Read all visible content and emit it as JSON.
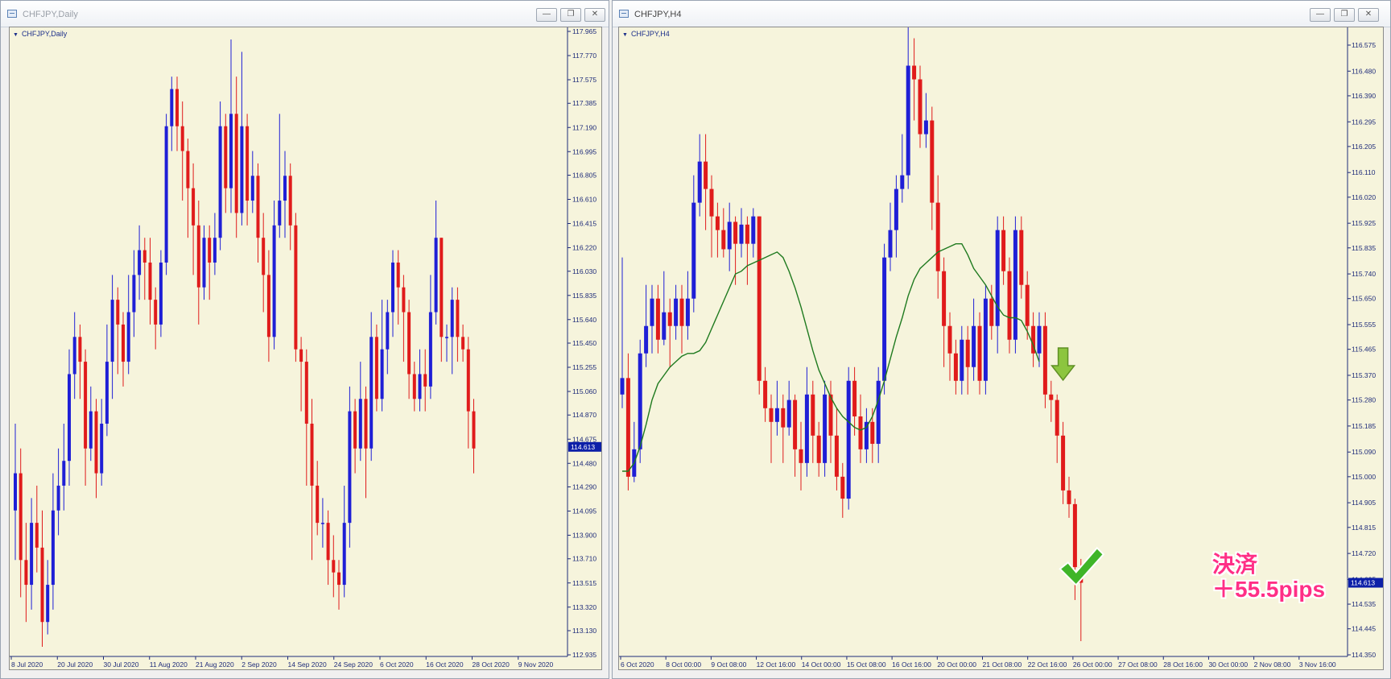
{
  "left_window": {
    "title": "CHFJPY,Daily",
    "chart_label": "CHFJPY,Daily",
    "controls": {
      "minimize": "—",
      "restore": "❐",
      "close": "✕"
    },
    "chart_data": {
      "type": "candlestick",
      "symbol": "CHFJPY",
      "timeframe": "Daily",
      "ylim": [
        112.935,
        117.965
      ],
      "y_ticks": [
        117.965,
        117.77,
        117.575,
        117.385,
        117.19,
        116.995,
        116.805,
        116.61,
        116.415,
        116.22,
        116.03,
        115.835,
        115.64,
        115.45,
        115.255,
        115.06,
        114.87,
        114.675,
        114.48,
        114.29,
        114.095,
        113.9,
        113.71,
        113.515,
        113.32,
        113.13,
        112.935
      ],
      "x_ticks": [
        "8 Jul 2020",
        "20 Jul 2020",
        "30 Jul 2020",
        "11 Aug 2020",
        "21 Aug 2020",
        "2 Sep 2020",
        "14 Sep 2020",
        "24 Sep 2020",
        "6 Oct 2020",
        "16 Oct 2020",
        "28 Oct 2020",
        "9 Nov 2020"
      ],
      "current_price": "114.613",
      "candles": [
        [
          114.1,
          114.4,
          114.8,
          113.7
        ],
        [
          114.4,
          113.7,
          114.6,
          113.4
        ],
        [
          113.7,
          113.5,
          114.0,
          113.2
        ],
        [
          113.5,
          114.0,
          114.2,
          113.3
        ],
        [
          114.0,
          113.8,
          114.3,
          113.6
        ],
        [
          113.8,
          113.2,
          114.1,
          113.0
        ],
        [
          113.2,
          113.5,
          113.7,
          113.1
        ],
        [
          113.5,
          114.1,
          114.4,
          113.3
        ],
        [
          114.1,
          114.3,
          114.6,
          113.9
        ],
        [
          114.3,
          114.5,
          114.8,
          114.1
        ],
        [
          114.5,
          115.2,
          115.4,
          114.3
        ],
        [
          115.2,
          115.5,
          115.7,
          115.0
        ],
        [
          115.5,
          115.3,
          115.6,
          115.0
        ],
        [
          115.3,
          114.6,
          115.4,
          114.3
        ],
        [
          114.6,
          114.9,
          115.1,
          114.5
        ],
        [
          114.9,
          114.4,
          115.0,
          114.2
        ],
        [
          114.4,
          114.8,
          115.0,
          114.3
        ],
        [
          114.8,
          115.3,
          115.6,
          114.7
        ],
        [
          115.3,
          115.8,
          116.0,
          115.0
        ],
        [
          115.8,
          115.6,
          115.9,
          115.2
        ],
        [
          115.6,
          115.3,
          115.7,
          115.1
        ],
        [
          115.3,
          115.7,
          116.0,
          115.2
        ],
        [
          115.7,
          116.0,
          116.2,
          115.5
        ],
        [
          116.0,
          116.2,
          116.4,
          115.8
        ],
        [
          116.2,
          116.1,
          116.3,
          115.8
        ],
        [
          116.1,
          115.8,
          116.3,
          115.6
        ],
        [
          115.8,
          115.6,
          115.9,
          115.4
        ],
        [
          115.6,
          116.1,
          116.2,
          115.5
        ],
        [
          116.1,
          117.2,
          117.3,
          116.0
        ],
        [
          117.2,
          117.5,
          117.6,
          117.0
        ],
        [
          117.5,
          117.2,
          117.6,
          117.0
        ],
        [
          117.2,
          117.0,
          117.4,
          116.6
        ],
        [
          117.0,
          116.7,
          117.1,
          116.3
        ],
        [
          116.7,
          116.4,
          116.9,
          116.0
        ],
        [
          116.4,
          115.9,
          116.6,
          115.6
        ],
        [
          115.9,
          116.3,
          116.4,
          115.8
        ],
        [
          116.3,
          116.1,
          116.4,
          115.8
        ],
        [
          116.1,
          116.3,
          116.5,
          116.0
        ],
        [
          116.3,
          117.2,
          117.4,
          116.2
        ],
        [
          117.2,
          116.7,
          117.3,
          116.5
        ],
        [
          116.7,
          117.3,
          117.9,
          116.5
        ],
        [
          117.3,
          116.5,
          117.6,
          116.3
        ],
        [
          116.5,
          117.2,
          117.8,
          116.4
        ],
        [
          117.2,
          116.6,
          117.3,
          116.4
        ],
        [
          116.6,
          116.8,
          117.0,
          116.5
        ],
        [
          116.8,
          116.3,
          116.9,
          116.1
        ],
        [
          116.3,
          116.0,
          116.5,
          115.7
        ],
        [
          116.0,
          115.5,
          116.2,
          115.3
        ],
        [
          115.5,
          116.4,
          116.6,
          115.4
        ],
        [
          116.4,
          116.6,
          117.3,
          116.3
        ],
        [
          116.6,
          116.8,
          117.0,
          116.3
        ],
        [
          116.8,
          116.4,
          116.9,
          116.2
        ],
        [
          116.4,
          115.4,
          116.5,
          115.3
        ],
        [
          115.4,
          115.3,
          115.5,
          114.9
        ],
        [
          115.3,
          114.8,
          115.4,
          114.3
        ],
        [
          114.8,
          114.3,
          115.0,
          113.7
        ],
        [
          114.3,
          114.0,
          114.5,
          113.9
        ],
        [
          114.0,
          114.0,
          114.2,
          113.8
        ],
        [
          114.0,
          113.7,
          114.1,
          113.5
        ],
        [
          113.7,
          113.6,
          113.9,
          113.4
        ],
        [
          113.6,
          113.5,
          113.7,
          113.3
        ],
        [
          113.5,
          114.0,
          114.3,
          113.4
        ],
        [
          114.0,
          114.9,
          115.1,
          113.8
        ],
        [
          114.9,
          114.6,
          115.0,
          114.4
        ],
        [
          114.6,
          115.0,
          115.3,
          114.5
        ],
        [
          115.0,
          114.6,
          115.1,
          114.2
        ],
        [
          114.6,
          115.5,
          115.7,
          114.5
        ],
        [
          115.5,
          115.0,
          115.6,
          114.9
        ],
        [
          115.0,
          115.4,
          115.8,
          114.9
        ],
        [
          115.4,
          115.7,
          115.8,
          115.2
        ],
        [
          115.7,
          116.1,
          116.2,
          115.5
        ],
        [
          116.1,
          115.9,
          116.2,
          115.6
        ],
        [
          115.9,
          115.7,
          116.0,
          115.3
        ],
        [
          115.7,
          115.2,
          115.8,
          115.0
        ],
        [
          115.2,
          115.0,
          115.3,
          114.9
        ],
        [
          115.0,
          115.2,
          115.4,
          114.9
        ],
        [
          115.2,
          115.1,
          115.4,
          114.9
        ],
        [
          115.1,
          115.7,
          116.0,
          115.0
        ],
        [
          115.7,
          116.3,
          116.6,
          115.6
        ],
        [
          116.3,
          115.5,
          116.3,
          115.3
        ],
        [
          115.5,
          115.5,
          115.6,
          115.3
        ],
        [
          115.5,
          115.8,
          115.9,
          115.2
        ],
        [
          115.8,
          115.5,
          115.9,
          115.3
        ],
        [
          115.5,
          115.4,
          115.6,
          115.3
        ],
        [
          115.4,
          114.9,
          115.5,
          114.6
        ],
        [
          114.9,
          114.6,
          115.0,
          114.4
        ]
      ]
    }
  },
  "right_window": {
    "title": "CHFJPY,H4",
    "chart_label": "CHFJPY,H4",
    "controls": {
      "minimize": "—",
      "restore": "❐",
      "close": "✕"
    },
    "annotation": {
      "line1": "決済",
      "line2": "＋55.5pips"
    },
    "chart_data": {
      "type": "candlestick",
      "symbol": "CHFJPY",
      "timeframe": "H4",
      "ylim": [
        114.35,
        116.575
      ],
      "y_ticks": [
        116.575,
        116.48,
        116.39,
        116.295,
        116.205,
        116.11,
        116.02,
        115.925,
        115.835,
        115.74,
        115.65,
        115.555,
        115.465,
        115.37,
        115.28,
        115.185,
        115.09,
        115.0,
        114.905,
        114.815,
        114.72,
        114.625,
        114.535,
        114.445,
        114.35
      ],
      "x_ticks": [
        "6 Oct 2020",
        "8 Oct 00:00",
        "9 Oct 08:00",
        "12 Oct 16:00",
        "14 Oct 00:00",
        "15 Oct 08:00",
        "16 Oct 16:00",
        "20 Oct 00:00",
        "21 Oct 08:00",
        "22 Oct 16:00",
        "26 Oct 00:00",
        "27 Oct 08:00",
        "28 Oct 16:00",
        "30 Oct 00:00",
        "2 Nov 08:00",
        "3 Nov 16:00"
      ],
      "current_price": "114.613",
      "ma_series": [
        115.02,
        115.02,
        115.05,
        115.11,
        115.19,
        115.28,
        115.34,
        115.37,
        115.4,
        115.42,
        115.44,
        115.45,
        115.45,
        115.46,
        115.49,
        115.54,
        115.59,
        115.64,
        115.69,
        115.74,
        115.75,
        115.77,
        115.78,
        115.79,
        115.8,
        115.81,
        115.82,
        115.8,
        115.75,
        115.69,
        115.62,
        115.54,
        115.46,
        115.39,
        115.34,
        115.29,
        115.25,
        115.22,
        115.2,
        115.18,
        115.17,
        115.18,
        115.22,
        115.28,
        115.35,
        115.43,
        115.51,
        115.58,
        115.66,
        115.72,
        115.76,
        115.78,
        115.8,
        115.82,
        115.83,
        115.84,
        115.85,
        115.85,
        115.81,
        115.76,
        115.73,
        115.7,
        115.66,
        115.62,
        115.59,
        115.58,
        115.58,
        115.57,
        115.53,
        115.48,
        115.42
      ],
      "candles": [
        [
          115.3,
          115.36,
          115.8,
          115.25
        ],
        [
          115.36,
          115.0,
          115.45,
          114.95
        ],
        [
          115.0,
          115.1,
          115.2,
          114.98
        ],
        [
          115.1,
          115.45,
          115.5,
          115.05
        ],
        [
          115.45,
          115.55,
          115.7,
          115.4
        ],
        [
          115.55,
          115.65,
          115.7,
          115.45
        ],
        [
          115.65,
          115.5,
          115.7,
          115.45
        ],
        [
          115.5,
          115.6,
          115.75,
          115.48
        ],
        [
          115.6,
          115.55,
          115.65,
          115.4
        ],
        [
          115.55,
          115.65,
          115.7,
          115.5
        ],
        [
          115.65,
          115.55,
          115.7,
          115.45
        ],
        [
          115.55,
          115.65,
          115.75,
          115.5
        ],
        [
          115.65,
          116.0,
          116.1,
          115.6
        ],
        [
          116.0,
          116.15,
          116.25,
          115.95
        ],
        [
          116.15,
          116.05,
          116.25,
          115.9
        ],
        [
          116.05,
          115.95,
          116.1,
          115.8
        ],
        [
          115.95,
          115.9,
          116.0,
          115.8
        ],
        [
          115.9,
          115.83,
          115.98,
          115.8
        ],
        [
          115.83,
          115.93,
          116.0,
          115.75
        ],
        [
          115.93,
          115.85,
          115.95,
          115.7
        ],
        [
          115.85,
          115.92,
          115.98,
          115.8
        ],
        [
          115.92,
          115.85,
          115.95,
          115.7
        ],
        [
          115.85,
          115.95,
          115.98,
          115.8
        ],
        [
          115.95,
          115.35,
          115.95,
          115.3
        ],
        [
          115.35,
          115.25,
          115.4,
          115.2
        ],
        [
          115.25,
          115.2,
          115.3,
          115.05
        ],
        [
          115.2,
          115.25,
          115.35,
          115.15
        ],
        [
          115.25,
          115.18,
          115.3,
          115.05
        ],
        [
          115.18,
          115.28,
          115.35,
          115.15
        ],
        [
          115.28,
          115.1,
          115.3,
          115.0
        ],
        [
          115.1,
          115.05,
          115.2,
          114.95
        ],
        [
          115.05,
          115.3,
          115.4,
          115.0
        ],
        [
          115.3,
          115.15,
          115.35,
          115.05
        ],
        [
          115.15,
          115.05,
          115.2,
          115.0
        ],
        [
          115.05,
          115.3,
          115.35,
          115.0
        ],
        [
          115.3,
          115.15,
          115.35,
          115.05
        ],
        [
          115.15,
          115.0,
          115.25,
          114.95
        ],
        [
          115.0,
          114.92,
          115.05,
          114.85
        ],
        [
          114.92,
          115.35,
          115.4,
          114.88
        ],
        [
          115.35,
          115.22,
          115.4,
          115.15
        ],
        [
          115.22,
          115.1,
          115.3,
          115.05
        ],
        [
          115.1,
          115.2,
          115.25,
          115.05
        ],
        [
          115.2,
          115.12,
          115.25,
          115.05
        ],
        [
          115.12,
          115.35,
          115.4,
          115.05
        ],
        [
          115.35,
          115.8,
          115.85,
          115.3
        ],
        [
          115.8,
          115.9,
          116.0,
          115.75
        ],
        [
          115.9,
          116.05,
          116.1,
          115.8
        ],
        [
          116.05,
          116.1,
          116.25,
          116.0
        ],
        [
          116.1,
          116.5,
          116.7,
          116.05
        ],
        [
          116.5,
          116.45,
          116.6,
          116.3
        ],
        [
          116.45,
          116.25,
          116.5,
          116.2
        ],
        [
          116.25,
          116.3,
          116.4,
          116.2
        ],
        [
          116.3,
          116.0,
          116.35,
          115.9
        ],
        [
          116.0,
          115.75,
          116.1,
          115.65
        ],
        [
          115.75,
          115.55,
          115.8,
          115.4
        ],
        [
          115.55,
          115.45,
          115.6,
          115.35
        ],
        [
          115.45,
          115.35,
          115.5,
          115.3
        ],
        [
          115.35,
          115.5,
          115.55,
          115.3
        ],
        [
          115.5,
          115.4,
          115.55,
          115.3
        ],
        [
          115.4,
          115.55,
          115.65,
          115.35
        ],
        [
          115.55,
          115.35,
          115.6,
          115.3
        ],
        [
          115.35,
          115.65,
          115.7,
          115.3
        ],
        [
          115.65,
          115.55,
          115.7,
          115.5
        ],
        [
          115.55,
          115.9,
          115.95,
          115.45
        ],
        [
          115.9,
          115.75,
          115.95,
          115.7
        ],
        [
          115.75,
          115.5,
          115.8,
          115.45
        ],
        [
          115.5,
          115.9,
          115.95,
          115.45
        ],
        [
          115.9,
          115.7,
          115.95,
          115.65
        ],
        [
          115.7,
          115.55,
          115.75,
          115.5
        ],
        [
          115.55,
          115.45,
          115.6,
          115.4
        ],
        [
          115.45,
          115.55,
          115.6,
          115.4
        ],
        [
          115.55,
          115.3,
          115.6,
          115.25
        ],
        [
          115.3,
          115.28,
          115.35,
          115.2
        ],
        [
          115.28,
          115.15,
          115.3,
          115.05
        ],
        [
          115.15,
          114.95,
          115.2,
          114.9
        ],
        [
          114.95,
          114.9,
          115.0,
          114.85
        ],
        [
          114.9,
          114.67,
          114.92,
          114.55
        ],
        [
          114.67,
          114.613,
          114.7,
          114.4
        ]
      ]
    }
  }
}
